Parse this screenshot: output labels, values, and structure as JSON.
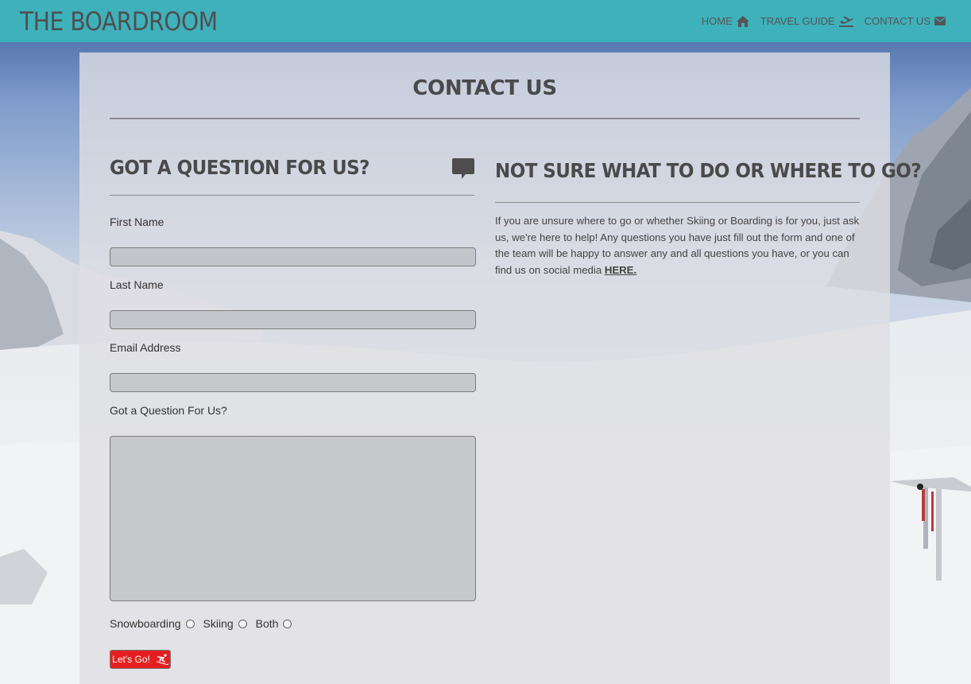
{
  "header": {
    "brand": "THE BOARDROOM",
    "nav": [
      {
        "label": "HOME",
        "icon": "home-icon"
      },
      {
        "label": "TRAVEL GUIDE",
        "icon": "plane-icon"
      },
      {
        "label": "CONTACT US",
        "icon": "envelope-icon"
      }
    ]
  },
  "page": {
    "title": "CONTACT US"
  },
  "form": {
    "heading": "GOT A QUESTION FOR US?",
    "heading_icon": "chat-bubble-icon",
    "first_name_label": "First Name",
    "first_name_value": "",
    "last_name_label": "Last Name",
    "last_name_value": "",
    "email_label": "Email Address",
    "email_value": "",
    "question_label": "Got a Question For Us?",
    "question_value": "",
    "options": [
      "Snowboarding",
      "Skiing",
      "Both"
    ],
    "submit_label": "Let's Go!",
    "submit_icon": "skier-icon"
  },
  "info": {
    "heading": "NOT SURE WHAT TO DO OR WHERE TO GO?",
    "text": "If you are unsure where to go or whether Skiing or Boarding is for you, just ask us, we're here to help! Any questions you have just fill out the form and one of the team will be happy to answer any and all questions you have, or you can find us on social media ",
    "link": "HERE."
  },
  "colors": {
    "header_bg": "#3eb1bb",
    "button_bg": "#e51f1f",
    "text": "#4a4a4a"
  }
}
